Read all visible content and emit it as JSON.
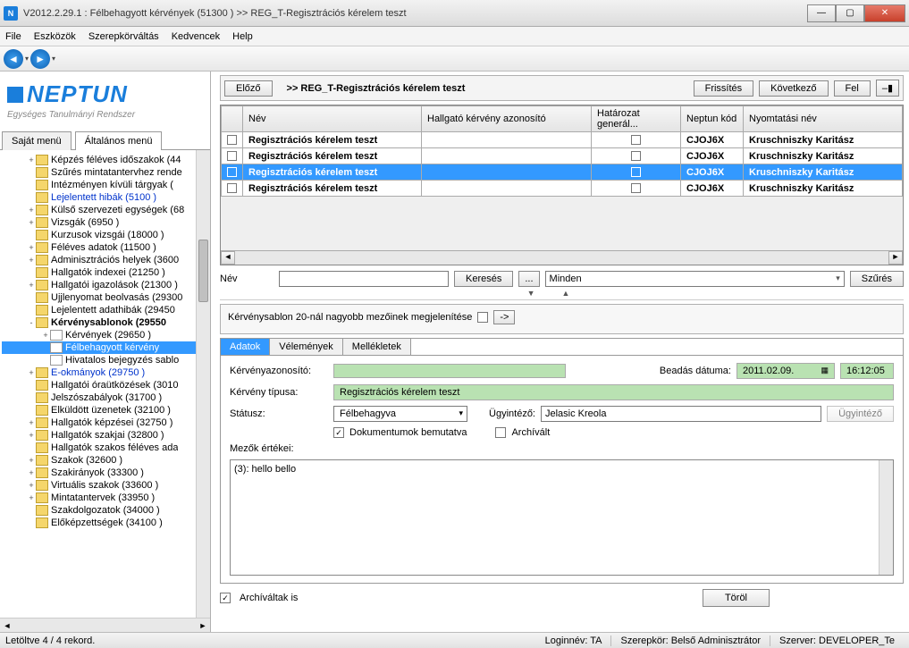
{
  "window": {
    "title": "V2012.2.29.1 : Félbehagyott kérvények (51300  )  >> REG_T-Regisztrációs kérelem teszt",
    "min": "—",
    "max": "▢",
    "close": "✕"
  },
  "menu": {
    "file": "File",
    "eszkozok": "Eszközök",
    "szerepkor": "Szerepkörváltás",
    "kedvencek": "Kedvencek",
    "help": "Help"
  },
  "logo": {
    "name": "NEPTUN",
    "sub": "Egységes Tanulmányi Rendszer"
  },
  "side_tabs": {
    "sajat": "Saját menü",
    "altalanos": "Általános menü"
  },
  "tree": [
    {
      "t": "Képzés féléves időszakok (44",
      "ind": 1,
      "exp": "+"
    },
    {
      "t": "Szűrés mintatantervhez rende",
      "ind": 1
    },
    {
      "t": "Intézményen kívüli tárgyak (",
      "ind": 1
    },
    {
      "t": "Lejelentett hibák (5100  )",
      "ind": 1,
      "blue": true
    },
    {
      "t": "Külső szervezeti egységek (68",
      "ind": 1,
      "exp": "+"
    },
    {
      "t": "Vizsgák (6950  )",
      "ind": 1,
      "exp": "+"
    },
    {
      "t": "Kurzusok vizsgái (18000  )",
      "ind": 1
    },
    {
      "t": "Féléves adatok (11500  )",
      "ind": 1,
      "exp": "+"
    },
    {
      "t": "Adminisztrációs helyek (3600",
      "ind": 1,
      "exp": "+"
    },
    {
      "t": "Hallgatók indexei (21250  )",
      "ind": 1
    },
    {
      "t": "Hallgatói igazolások (21300  )",
      "ind": 1,
      "exp": "+"
    },
    {
      "t": "Ujjlenyomat beolvasás (29300",
      "ind": 1
    },
    {
      "t": "Lejelentett adathibák (29450",
      "ind": 1
    },
    {
      "t": "Kérvénysablonok (29550",
      "ind": 1,
      "exp": "-",
      "bold": true
    },
    {
      "t": "Kérvények (29650  )",
      "ind": 2,
      "exp": "+",
      "doc": true
    },
    {
      "t": "Félbehagyott kérvény",
      "ind": 2,
      "doc": true,
      "sel": true
    },
    {
      "t": "Hivatalos bejegyzés sablo",
      "ind": 2,
      "doc": true
    },
    {
      "t": "E-okmányok (29750  )",
      "ind": 1,
      "exp": "+",
      "blue": true
    },
    {
      "t": "Hallgatói óraütközések (3010",
      "ind": 1
    },
    {
      "t": "Jelszószabályok (31700  )",
      "ind": 1
    },
    {
      "t": "Elküldött üzenetek (32100  )",
      "ind": 1
    },
    {
      "t": "Hallgatók képzései (32750  )",
      "ind": 1,
      "exp": "+"
    },
    {
      "t": "Hallgatók szakjai (32800  )",
      "ind": 1,
      "exp": "+"
    },
    {
      "t": "Hallgatók szakos féléves ada",
      "ind": 1
    },
    {
      "t": "Szakok (32600  )",
      "ind": 1,
      "exp": "+"
    },
    {
      "t": "Szakirányok (33300  )",
      "ind": 1,
      "exp": "+"
    },
    {
      "t": "Virtuális szakok (33600  )",
      "ind": 1,
      "exp": "+"
    },
    {
      "t": "Mintatantervek (33950  )",
      "ind": 1,
      "exp": "+"
    },
    {
      "t": "Szakdolgozatok (34000  )",
      "ind": 1
    },
    {
      "t": "Előképzettségek (34100  )",
      "ind": 1
    }
  ],
  "top": {
    "elozo": "Előző",
    "frissites": "Frissítés",
    "kovetkezo": "Következő",
    "fel": "Fel",
    "pin": "–▮",
    "crumb": ">> REG_T-Regisztrációs kérelem teszt"
  },
  "grid": {
    "cols": {
      "nev": "Név",
      "hka": "Hallgató kérvény azonosító",
      "hg": "Határozat generál...",
      "nkod": "Neptun kód",
      "nynev": "Nyomtatási név"
    },
    "rows": [
      {
        "nev": "Regisztrációs kérelem teszt",
        "hka": "",
        "hg": false,
        "nkod": "CJOJ6X",
        "nynev": "Kruschniszky Karitász"
      },
      {
        "nev": "Regisztrációs kérelem teszt",
        "hka": "",
        "hg": false,
        "nkod": "CJOJ6X",
        "nynev": "Kruschniszky Karitász"
      },
      {
        "nev": "Regisztrációs kérelem teszt",
        "hka": "",
        "hg": false,
        "nkod": "CJOJ6X",
        "nynev": "Kruschniszky Karitász",
        "sel": true
      },
      {
        "nev": "Regisztrációs kérelem teszt",
        "hka": "",
        "hg": false,
        "nkod": "CJOJ6X",
        "nynev": "Kruschniszky Karitász"
      }
    ]
  },
  "search": {
    "label": "Név",
    "kereses": "Keresés",
    "dots": "...",
    "minden": "Minden",
    "szures": "Szűrés"
  },
  "panel": {
    "line": "Kérvénysablon 20-nál nagyobb mezőinek megjelenítése",
    "arrow": "->"
  },
  "sub_tabs": {
    "adatok": "Adatok",
    "velemenyek": "Vélemények",
    "mellekletek": "Mellékletek"
  },
  "form": {
    "kaz_lbl": "Kérvényazonosító:",
    "kaz": "",
    "bead_lbl": "Beadás dátuma:",
    "bead_date": "2011.02.09.",
    "bead_time": "16:12:05",
    "tip_lbl": "Kérvény típusa:",
    "tip": "Regisztrációs kérelem teszt",
    "stat_lbl": "Státusz:",
    "stat": "Félbehagyva",
    "ugy_lbl": "Ügyintéző:",
    "ugy": "Jelasic Kreola",
    "ugy_btn": "Ügyintéző",
    "dok": "Dokumentumok bemutatva",
    "arch": "Archívált",
    "mezok": "Mezők értékei:",
    "memo": "(3): hello bello",
    "arch_is": "Archíváltak is",
    "torol": "Töröl"
  },
  "status": {
    "rec": "Letöltve 4 / 4 rekord.",
    "login": "Loginnév: TA",
    "szerep": "Szerepkör: Belső Adminisztrátor",
    "szerver": "Szerver: DEVELOPER_Te"
  }
}
